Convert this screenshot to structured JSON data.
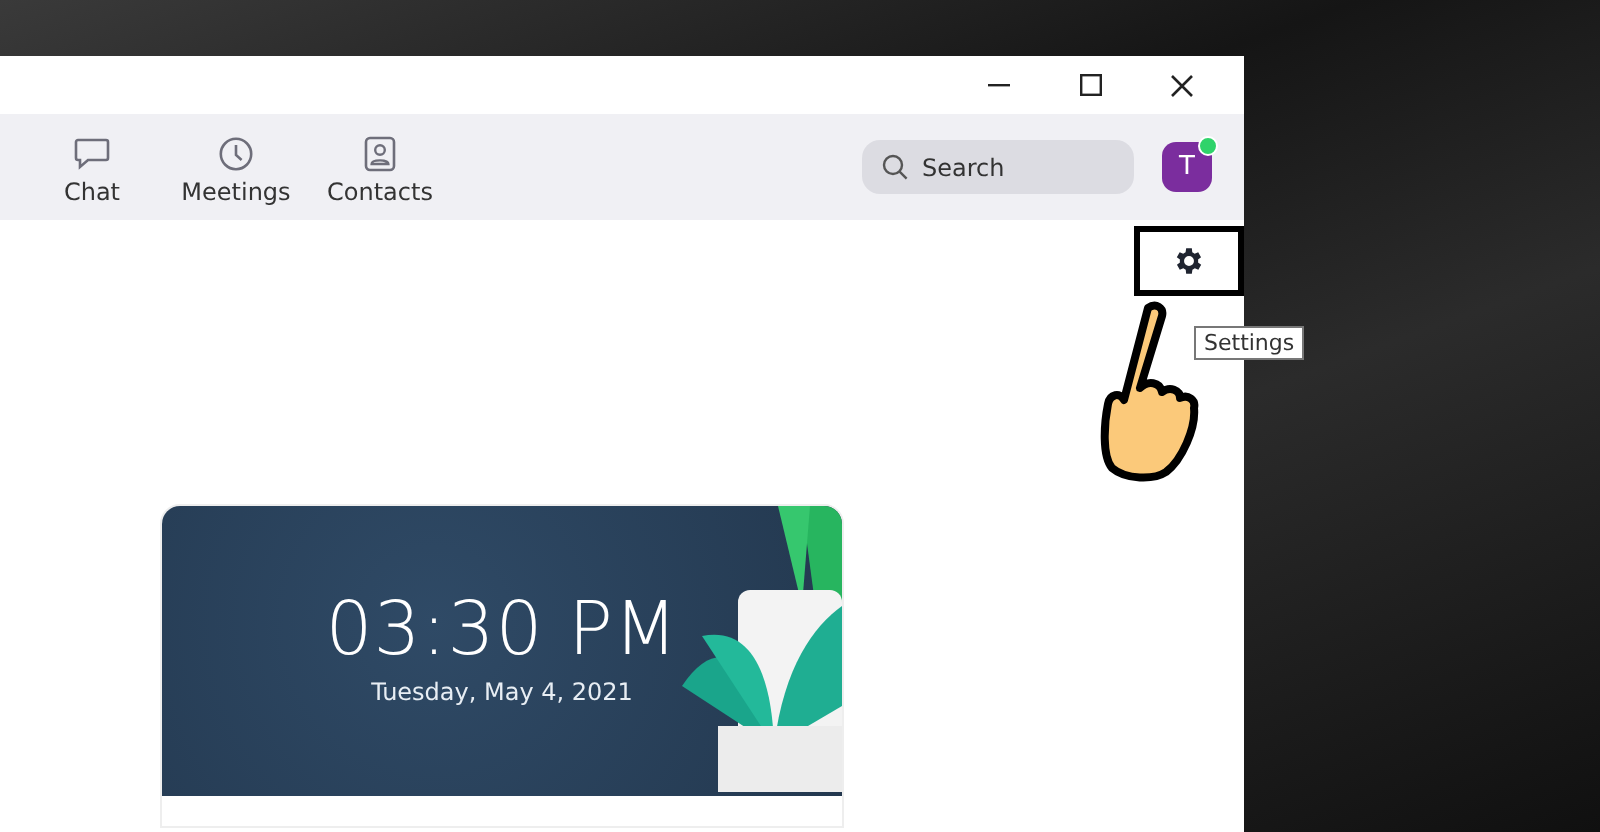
{
  "nav": {
    "tabs": [
      {
        "label": "Chat",
        "kind": "chat"
      },
      {
        "label": "Meetings",
        "kind": "meetings"
      },
      {
        "label": "Contacts",
        "kind": "contacts"
      }
    ],
    "search": {
      "placeholder": "Search"
    },
    "avatar": {
      "initial": "T"
    }
  },
  "settings_tooltip": "Settings",
  "clock": {
    "time": "03:30 PM",
    "date": "Tuesday, May 4, 2021"
  }
}
